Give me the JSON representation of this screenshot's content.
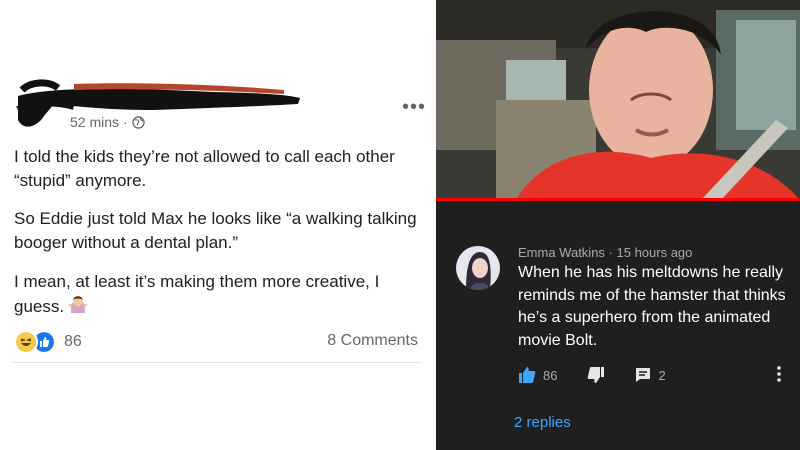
{
  "post": {
    "time": "52 mins",
    "paragraph_1": "I told the kids they’re not allowed to call each other “stupid” anymore.",
    "paragraph_2": "So Eddie just told Max he looks like “a walking talking booger without a dental plan.”",
    "paragraph_3": "I mean, at least it’s making them more creative, I guess.",
    "reaction_count": "86",
    "comments_label": "8 Comments",
    "icons": [
      "globe-icon",
      "more-icon",
      "haha-reaction-icon",
      "like-reaction-icon",
      "shrug-emoji"
    ]
  },
  "comment": {
    "author": "Emma Watkins",
    "time": "15 hours ago",
    "text": "When he has his meltdowns he really reminds me of the hamster that thinks he’s a superhero from the animated movie Bolt.",
    "like_count": "86",
    "reply_count": "2",
    "replies_label": "2 replies",
    "icons": [
      "thumbs-up-icon",
      "thumbs-down-icon",
      "reply-icon",
      "more-vert-icon"
    ]
  },
  "colors": {
    "facebook_text": "#1c1e21",
    "facebook_meta": "#65676b",
    "dark_bg": "#1f1f1f",
    "link_blue": "#3ea6ff",
    "like_blue": "#3ea6ff",
    "progress_red": "#ff0000"
  }
}
